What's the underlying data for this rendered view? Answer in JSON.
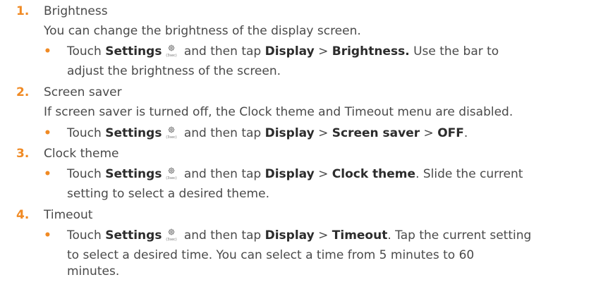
{
  "items": [
    {
      "number": "1.",
      "title": "Brightness",
      "description": "You can change the brightness of the display screen.",
      "bullet": {
        "touch": "Touch",
        "settings": "Settings",
        "then_tap": "and then tap",
        "display": "Display",
        "sep": ">",
        "target": "Brightness.",
        "line1_tail": "Use the bar to",
        "line2": "adjust the brightness of the screen."
      }
    },
    {
      "number": "2.",
      "title": "Screen saver",
      "description": "If screen saver is turned off, the Clock theme and Timeout menu are disabled.",
      "bullet": {
        "touch": "Touch",
        "settings": "Settings",
        "then_tap": "and then tap",
        "display": "Display",
        "sep": ">",
        "target": "Screen saver",
        "sep2": ">",
        "value": "OFF",
        "end": "."
      }
    },
    {
      "number": "3.",
      "title": "Clock theme",
      "bullet": {
        "touch": "Touch",
        "settings": "Settings",
        "then_tap": "and then tap",
        "display": "Display",
        "sep": ">",
        "target": "Clock theme",
        "line1_tail": ". Slide the current",
        "line2": "setting to select a desired theme."
      }
    },
    {
      "number": "4.",
      "title": "Timeout",
      "bullet": {
        "touch": "Touch",
        "settings": "Settings",
        "then_tap": "and then tap",
        "display": "Display",
        "sep": ">",
        "target": "Timeout",
        "line1_tail": ". Tap the current setting",
        "line2": "to select a desired time. You can select a time from 5 minutes to 60",
        "line3": "minutes."
      }
    }
  ],
  "icon": {
    "name": "settings-gear-icon",
    "caption": "(3sec)"
  }
}
